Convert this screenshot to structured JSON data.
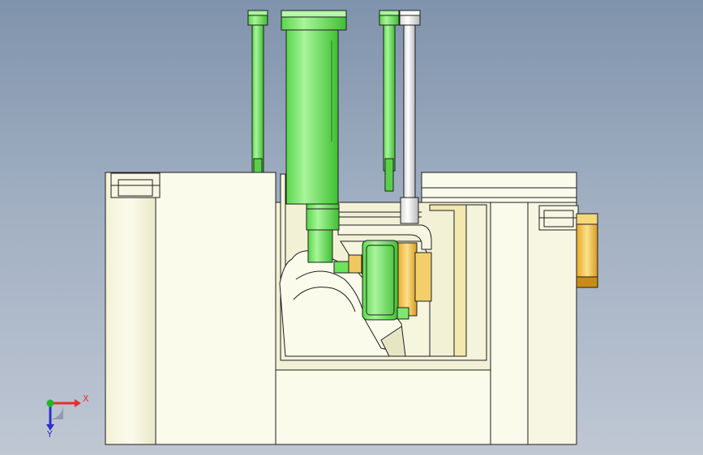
{
  "viewport": {
    "background_top": "#7f93ac",
    "background_bottom": "#bfc7d3"
  },
  "triad": {
    "x_label": "X",
    "y_label": "Y",
    "x_color": "#e23030",
    "y_color": "#2b2fd0",
    "origin_color": "#22b822"
  },
  "model": {
    "pin_color": "#7de86e",
    "block_color": "#fbfbec",
    "insert_color": "#f0c860",
    "edge_color": "#1e1e1e",
    "components": [
      "mold-base",
      "green-guide-pins",
      "white-ejector-pin",
      "cavity-insert",
      "yellow-side-block"
    ]
  }
}
